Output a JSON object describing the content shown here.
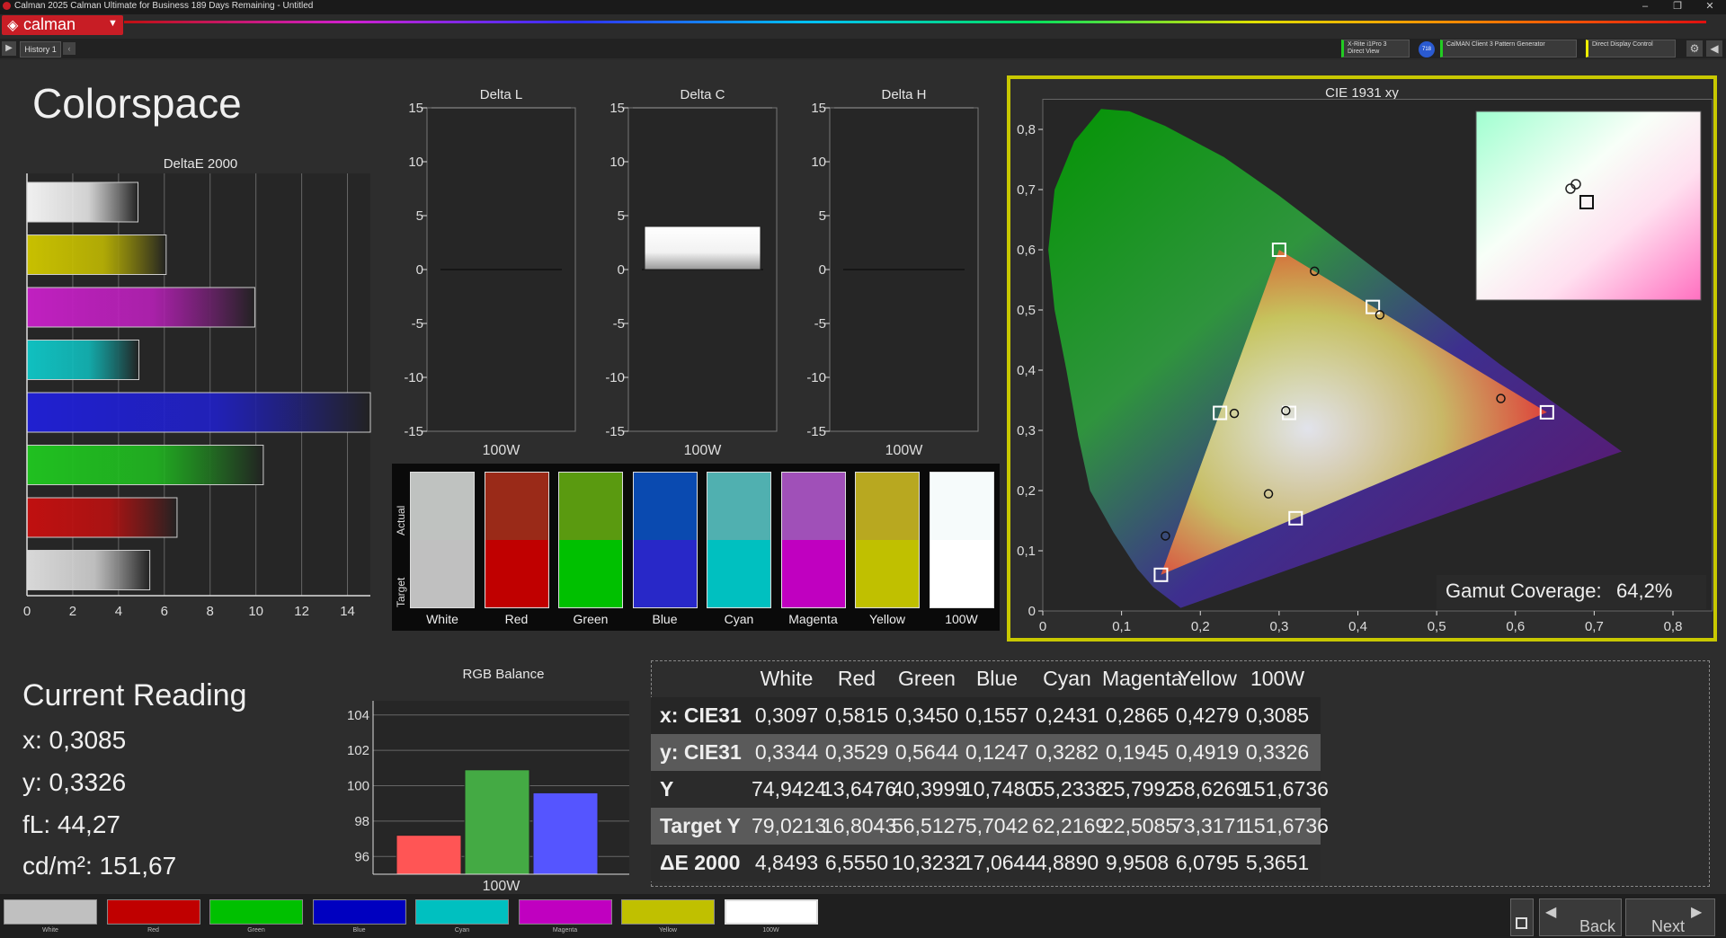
{
  "window": {
    "title": "Calman 2025 Calman Ultimate for Business 189 Days Remaining  - Untitled",
    "logo": "calman"
  },
  "toolbar": {
    "history_tab": "History 1",
    "meter_line1": "X-Rite i1Pro 3",
    "meter_line2": "Direct View",
    "meter_badge": "718",
    "pattern_gen": "CalMAN Client 3 Pattern Generator",
    "display_control": "Direct Display Control"
  },
  "page": {
    "title": "Colorspace"
  },
  "deltae": {
    "title": "DeltaE 2000",
    "ticks": [
      "0",
      "2",
      "4",
      "6",
      "8",
      "10",
      "12",
      "14"
    ],
    "bars": [
      {
        "name": "White",
        "value": 4.8493,
        "color": "#f0f0f0"
      },
      {
        "name": "Yellow",
        "value": 6.0795,
        "color": "#c8c000"
      },
      {
        "name": "Magenta",
        "value": 9.9508,
        "color": "#c020c0"
      },
      {
        "name": "Cyan",
        "value": 4.889,
        "color": "#10c0c0"
      },
      {
        "name": "Blue",
        "value": 17.0644,
        "color": "#2020d0"
      },
      {
        "name": "Green",
        "value": 10.3232,
        "color": "#20c020"
      },
      {
        "name": "Red",
        "value": 6.555,
        "color": "#c01010"
      },
      {
        "name": "100W",
        "value": 5.3651,
        "color": "#d8d8d8"
      }
    ]
  },
  "delta_charts": [
    {
      "title": "Delta L",
      "xlabel": "100W",
      "value": 0
    },
    {
      "title": "Delta C",
      "xlabel": "100W",
      "value": 4
    },
    {
      "title": "Delta H",
      "xlabel": "100W",
      "value": 0
    }
  ],
  "delta_ticks": [
    "15",
    "10",
    "5",
    "0",
    "-5",
    "-10",
    "-15"
  ],
  "swatches": {
    "actual_label": "Actual",
    "target_label": "Target",
    "items": [
      {
        "label": "White",
        "actual": "#bfc2c0",
        "target": "#c0c0c0"
      },
      {
        "label": "Red",
        "actual": "#9a2a18",
        "target": "#c00000"
      },
      {
        "label": "Green",
        "actual": "#5a9a10",
        "target": "#00c000"
      },
      {
        "label": "Blue",
        "actual": "#0a4ab0",
        "target": "#2828c8"
      },
      {
        "label": "Cyan",
        "actual": "#50b0b0",
        "target": "#00c0c0"
      },
      {
        "label": "Magenta",
        "actual": "#a050b8",
        "target": "#c000c0"
      },
      {
        "label": "Yellow",
        "actual": "#b8a820",
        "target": "#c0c000"
      },
      {
        "label": "100W",
        "actual": "#f6fbfb",
        "target": "#ffffff"
      }
    ]
  },
  "cie": {
    "title": "CIE 1931 xy",
    "gamut_label": "Gamut Coverage:",
    "gamut_value": "64,2%",
    "xticks": [
      "0",
      "0,1",
      "0,2",
      "0,3",
      "0,4",
      "0,5",
      "0,6",
      "0,7",
      "0,8"
    ],
    "yticks": [
      "0",
      "0,1",
      "0,2",
      "0,3",
      "0,4",
      "0,5",
      "0,6",
      "0,7",
      "0,8"
    ],
    "targets": [
      [
        0.64,
        0.33
      ],
      [
        0.3,
        0.6
      ],
      [
        0.15,
        0.06
      ],
      [
        0.225,
        0.329
      ],
      [
        0.321,
        0.154
      ],
      [
        0.419,
        0.505
      ],
      [
        0.3127,
        0.329
      ]
    ],
    "measured": [
      [
        0.5815,
        0.3529
      ],
      [
        0.345,
        0.5644
      ],
      [
        0.1557,
        0.1247
      ],
      [
        0.2431,
        0.3282
      ],
      [
        0.2865,
        0.1945
      ],
      [
        0.4279,
        0.4919
      ],
      [
        0.3085,
        0.3326
      ]
    ]
  },
  "current": {
    "title": "Current Reading",
    "x": "x: 0,3085",
    "y": "y: 0,3326",
    "fl": "fL: 44,27",
    "cd": "cd/m²: 151,67"
  },
  "rgb": {
    "title": "RGB Balance",
    "xlabel": "100W",
    "ticks": [
      "104",
      "102",
      "100",
      "98",
      "96"
    ],
    "values": [
      {
        "name": "R",
        "value": 97.2,
        "color": "#ff5555"
      },
      {
        "name": "G",
        "value": 100.9,
        "color": "#44aa44"
      },
      {
        "name": "B",
        "value": 99.6,
        "color": "#5555ff"
      }
    ]
  },
  "table": {
    "headers": [
      "White",
      "Red",
      "Green",
      "Blue",
      "Cyan",
      "Magenta",
      "Yellow",
      "100W"
    ],
    "rows": [
      {
        "label": "x: CIE31",
        "values": [
          "0,3097",
          "0,5815",
          "0,3450",
          "0,1557",
          "0,2431",
          "0,2865",
          "0,4279",
          "0,3085"
        ]
      },
      {
        "label": "y: CIE31",
        "values": [
          "0,3344",
          "0,3529",
          "0,5644",
          "0,1247",
          "0,3282",
          "0,1945",
          "0,4919",
          "0,3326"
        ]
      },
      {
        "label": "Y",
        "values": [
          "74,9424",
          "13,6476",
          "40,3999",
          "10,7480",
          "55,2338",
          "25,7992",
          "58,6269",
          "151,6736"
        ]
      },
      {
        "label": "Target Y",
        "values": [
          "79,0213",
          "16,8043",
          "56,5127",
          "5,7042",
          "62,2169",
          "22,5085",
          "73,3171",
          "151,6736"
        ]
      },
      {
        "label": "ΔE 2000",
        "values": [
          "4,8493",
          "6,5550",
          "10,3232",
          "17,0644",
          "4,8890",
          "9,9508",
          "6,0795",
          "5,3651"
        ]
      }
    ]
  },
  "bottom": {
    "swatches": [
      {
        "label": "White",
        "color": "#c0c0c0"
      },
      {
        "label": "Red",
        "color": "#c00000"
      },
      {
        "label": "Green",
        "color": "#00c000"
      },
      {
        "label": "Blue",
        "color": "#0000c0"
      },
      {
        "label": "Cyan",
        "color": "#00c0c0"
      },
      {
        "label": "Magenta",
        "color": "#c000c0"
      },
      {
        "label": "Yellow",
        "color": "#c0c000"
      },
      {
        "label": "100W",
        "color": "#ffffff"
      }
    ],
    "back": "Back",
    "next": "Next"
  }
}
